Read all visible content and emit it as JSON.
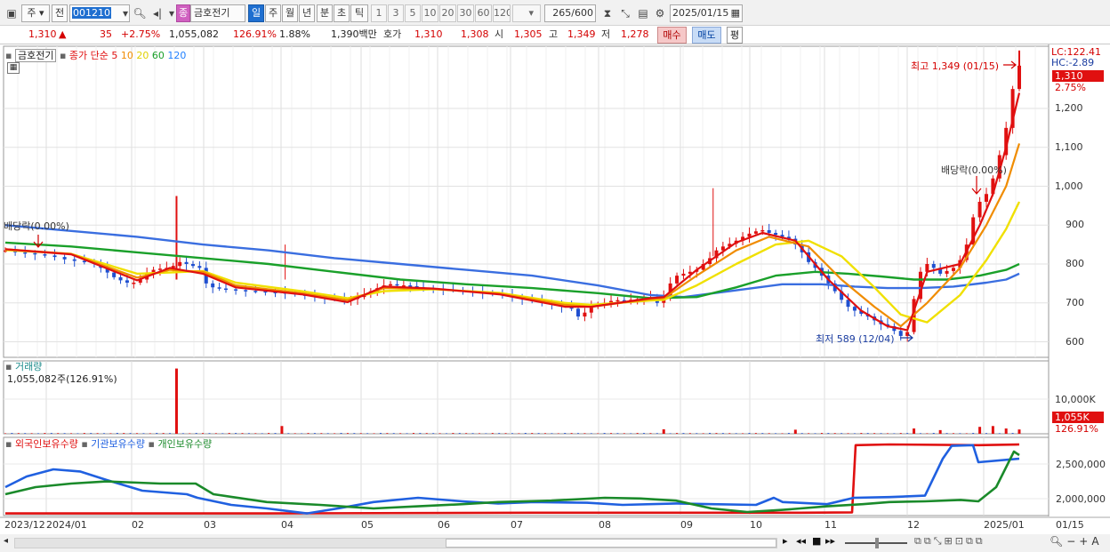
{
  "toolbar": {
    "market_type": "주",
    "prefix": "전",
    "stock_code": "001210",
    "stock_badge": "종",
    "stock_name": "금호전기",
    "period_tabs": [
      "일",
      "주",
      "월",
      "년",
      "분",
      "초",
      "틱"
    ],
    "active_period": "일",
    "interval_buttons": [
      "1",
      "3",
      "5",
      "10",
      "20",
      "30",
      "60",
      "120"
    ],
    "data_count": "265",
    "data_total": "/600",
    "date": "2025/01/15"
  },
  "quote": {
    "price": "1,310",
    "change": "35",
    "change_pct": "+2.75%",
    "volume": "1,055,082",
    "volume_ratio": "126.91%",
    "turnover": "1.88%",
    "amount": "1,390백만",
    "ask_label": "호가",
    "ask": "1,310",
    "bid": "1,308",
    "open_label": "시",
    "open": "1,305",
    "high_label": "고",
    "high": "1,349",
    "low_label": "저",
    "low": "1,278",
    "buy_label": "매수",
    "sell_label": "매도",
    "list_label": "평"
  },
  "price_pane": {
    "name": "금호전기",
    "ma_label": "종가 단순",
    "ma_periods": [
      {
        "label": "5",
        "color": "#e01010"
      },
      {
        "label": "10",
        "color": "#f08c00"
      },
      {
        "label": "20",
        "color": "#f0e000"
      },
      {
        "label": "60",
        "color": "#1aa02a"
      },
      {
        "label": "120",
        "color": "#2080ff"
      }
    ],
    "lc_label": "LC:122.41",
    "hc_label": "HC:-2.89",
    "current_price_tag": "1,310",
    "current_pct_tag": "2.75%",
    "high_annotation": "최고 1,349 (01/15)",
    "low_annotation": "최저 589 (12/04)",
    "dividend_left": "배당락(0.00%)",
    "dividend_right": "배당락(0.00%)"
  },
  "volume_pane": {
    "title": "거래량",
    "value": "1,055,082주(126.91%)",
    "axis_label": "10,000K",
    "tag_value": "1,055K",
    "tag_pct": "126.91%"
  },
  "holding_pane": {
    "series": [
      {
        "label": "외국인보유수량",
        "color": "#e01010"
      },
      {
        "label": "기관보유수량",
        "color": "#2060e0"
      },
      {
        "label": "개인보유수량",
        "color": "#1a8a2a"
      }
    ],
    "axis_labels": [
      "2,500,000",
      "2,000,000"
    ]
  },
  "x_axis": {
    "labels": [
      "2023/12",
      "2024/01",
      "02",
      "03",
      "04",
      "05",
      "06",
      "07",
      "08",
      "09",
      "10",
      "11",
      "12",
      "2025/01"
    ],
    "right_label": "01/15"
  },
  "chart_data": {
    "type": "line",
    "title": "금호전기",
    "ylim": [
      560,
      1360
    ],
    "y_ticks": [
      600,
      700,
      800,
      900,
      1000,
      1100,
      1200
    ],
    "y_tick_labels": [
      "600",
      "700",
      "800",
      "900",
      "1,000",
      "1,100",
      "1,200"
    ],
    "price_points": [
      [
        0,
        835
      ],
      [
        3,
        830
      ],
      [
        6,
        828
      ],
      [
        9,
        825
      ],
      [
        12,
        822
      ],
      [
        15,
        818
      ],
      [
        18,
        812
      ],
      [
        21,
        808
      ],
      [
        24,
        805
      ],
      [
        27,
        800
      ],
      [
        29,
        790
      ],
      [
        31,
        778
      ],
      [
        33,
        766
      ],
      [
        35,
        758
      ],
      [
        37,
        752
      ],
      [
        39,
        752
      ],
      [
        41,
        760
      ],
      [
        43,
        775
      ],
      [
        45,
        785
      ],
      [
        47,
        788
      ],
      [
        49,
        790
      ],
      [
        51,
        795
      ],
      [
        53,
        805
      ],
      [
        55,
        800
      ],
      [
        57,
        795
      ],
      [
        59,
        790
      ],
      [
        61,
        750
      ],
      [
        63,
        740
      ],
      [
        65,
        737
      ],
      [
        67,
        735
      ],
      [
        70,
        733
      ],
      [
        73,
        731
      ],
      [
        76,
        730
      ],
      [
        79,
        728
      ],
      [
        82,
        727
      ],
      [
        85,
        725
      ],
      [
        88,
        722
      ],
      [
        91,
        718
      ],
      [
        94,
        715
      ],
      [
        97,
        712
      ],
      [
        100,
        710
      ],
      [
        103,
        705
      ],
      [
        105,
        710
      ],
      [
        107,
        715
      ],
      [
        109,
        722
      ],
      [
        111,
        730
      ],
      [
        113,
        738
      ],
      [
        115,
        745
      ],
      [
        117,
        748
      ],
      [
        119,
        745
      ],
      [
        121,
        745
      ],
      [
        123,
        743
      ],
      [
        125,
        740
      ],
      [
        127,
        738
      ],
      [
        130,
        737
      ],
      [
        133,
        735
      ],
      [
        136,
        733
      ],
      [
        139,
        730
      ],
      [
        142,
        728
      ],
      [
        145,
        725
      ],
      [
        148,
        723
      ],
      [
        151,
        720
      ],
      [
        154,
        715
      ],
      [
        157,
        710
      ],
      [
        160,
        705
      ],
      [
        163,
        700
      ],
      [
        166,
        695
      ],
      [
        169,
        690
      ],
      [
        172,
        685
      ],
      [
        174,
        665
      ],
      [
        176,
        675
      ],
      [
        178,
        690
      ],
      [
        180,
        695
      ],
      [
        182,
        700
      ],
      [
        184,
        705
      ],
      [
        186,
        707
      ],
      [
        188,
        705
      ],
      [
        190,
        708
      ],
      [
        192,
        710
      ],
      [
        194,
        712
      ],
      [
        196,
        715
      ],
      [
        198,
        700
      ],
      [
        200,
        720
      ],
      [
        202,
        750
      ],
      [
        204,
        770
      ],
      [
        206,
        775
      ],
      [
        208,
        780
      ],
      [
        210,
        785
      ],
      [
        212,
        800
      ],
      [
        214,
        815
      ],
      [
        216,
        835
      ],
      [
        218,
        845
      ],
      [
        220,
        852
      ],
      [
        222,
        860
      ],
      [
        224,
        870
      ],
      [
        226,
        878
      ],
      [
        228,
        884
      ],
      [
        230,
        887
      ],
      [
        232,
        880
      ],
      [
        234,
        875
      ],
      [
        236,
        870
      ],
      [
        238,
        865
      ],
      [
        240,
        850
      ],
      [
        242,
        830
      ],
      [
        244,
        805
      ],
      [
        246,
        790
      ],
      [
        248,
        770
      ],
      [
        250,
        750
      ],
      [
        252,
        730
      ],
      [
        254,
        708
      ],
      [
        256,
        690
      ],
      [
        258,
        680
      ],
      [
        260,
        672
      ],
      [
        262,
        665
      ],
      [
        264,
        655
      ],
      [
        266,
        645
      ],
      [
        268,
        640
      ],
      [
        270,
        628
      ],
      [
        272,
        615
      ],
      [
        274,
        625
      ],
      [
        276,
        710
      ],
      [
        278,
        780
      ],
      [
        280,
        800
      ],
      [
        282,
        790
      ],
      [
        284,
        775
      ],
      [
        286,
        782
      ],
      [
        288,
        790
      ],
      [
        290,
        810
      ],
      [
        292,
        850
      ],
      [
        294,
        920
      ],
      [
        296,
        960
      ],
      [
        298,
        980
      ],
      [
        300,
        1020
      ],
      [
        302,
        1080
      ],
      [
        304,
        1150
      ],
      [
        306,
        1250
      ],
      [
        308,
        1310
      ]
    ],
    "ma5": [
      [
        0,
        838
      ],
      [
        20,
        825
      ],
      [
        40,
        758
      ],
      [
        50,
        790
      ],
      [
        60,
        775
      ],
      [
        70,
        740
      ],
      [
        90,
        722
      ],
      [
        104,
        702
      ],
      [
        115,
        742
      ],
      [
        130,
        737
      ],
      [
        150,
        722
      ],
      [
        170,
        690
      ],
      [
        178,
        690
      ],
      [
        196,
        712
      ],
      [
        200,
        715
      ],
      [
        210,
        785
      ],
      [
        222,
        855
      ],
      [
        230,
        880
      ],
      [
        240,
        860
      ],
      [
        250,
        760
      ],
      [
        260,
        680
      ],
      [
        268,
        640
      ],
      [
        274,
        630
      ],
      [
        280,
        780
      ],
      [
        290,
        800
      ],
      [
        296,
        900
      ],
      [
        300,
        980
      ],
      [
        304,
        1100
      ],
      [
        308,
        1240
      ]
    ],
    "ma10": [
      [
        0,
        838
      ],
      [
        20,
        826
      ],
      [
        40,
        765
      ],
      [
        50,
        785
      ],
      [
        60,
        780
      ],
      [
        70,
        745
      ],
      [
        90,
        725
      ],
      [
        104,
        707
      ],
      [
        115,
        738
      ],
      [
        130,
        736
      ],
      [
        150,
        724
      ],
      [
        170,
        695
      ],
      [
        178,
        690
      ],
      [
        196,
        710
      ],
      [
        200,
        712
      ],
      [
        210,
        770
      ],
      [
        222,
        835
      ],
      [
        232,
        870
      ],
      [
        244,
        845
      ],
      [
        254,
        760
      ],
      [
        264,
        690
      ],
      [
        272,
        640
      ],
      [
        280,
        700
      ],
      [
        290,
        790
      ],
      [
        298,
        900
      ],
      [
        304,
        1000
      ],
      [
        308,
        1110
      ]
    ],
    "ma20": [
      [
        0,
        836
      ],
      [
        20,
        826
      ],
      [
        40,
        775
      ],
      [
        50,
        778
      ],
      [
        60,
        782
      ],
      [
        70,
        752
      ],
      [
        90,
        730
      ],
      [
        104,
        712
      ],
      [
        115,
        730
      ],
      [
        130,
        735
      ],
      [
        150,
        726
      ],
      [
        170,
        700
      ],
      [
        178,
        695
      ],
      [
        196,
        706
      ],
      [
        200,
        708
      ],
      [
        210,
        745
      ],
      [
        222,
        800
      ],
      [
        234,
        850
      ],
      [
        244,
        860
      ],
      [
        254,
        820
      ],
      [
        264,
        740
      ],
      [
        272,
        670
      ],
      [
        280,
        650
      ],
      [
        290,
        720
      ],
      [
        298,
        810
      ],
      [
        304,
        890
      ],
      [
        308,
        960
      ]
    ],
    "ma60": [
      [
        0,
        855
      ],
      [
        20,
        845
      ],
      [
        40,
        830
      ],
      [
        60,
        815
      ],
      [
        80,
        800
      ],
      [
        100,
        780
      ],
      [
        120,
        760
      ],
      [
        140,
        748
      ],
      [
        160,
        738
      ],
      [
        180,
        725
      ],
      [
        196,
        712
      ],
      [
        210,
        715
      ],
      [
        222,
        740
      ],
      [
        234,
        770
      ],
      [
        246,
        780
      ],
      [
        256,
        775
      ],
      [
        266,
        768
      ],
      [
        276,
        760
      ],
      [
        286,
        760
      ],
      [
        296,
        770
      ],
      [
        304,
        785
      ],
      [
        308,
        800
      ]
    ],
    "ma120": [
      [
        0,
        900
      ],
      [
        20,
        885
      ],
      [
        40,
        870
      ],
      [
        60,
        850
      ],
      [
        80,
        835
      ],
      [
        100,
        815
      ],
      [
        120,
        800
      ],
      [
        140,
        785
      ],
      [
        160,
        770
      ],
      [
        180,
        745
      ],
      [
        196,
        720
      ],
      [
        206,
        715
      ],
      [
        220,
        730
      ],
      [
        236,
        748
      ],
      [
        248,
        748
      ],
      [
        258,
        742
      ],
      [
        268,
        738
      ],
      [
        278,
        738
      ],
      [
        288,
        742
      ],
      [
        298,
        752
      ],
      [
        304,
        760
      ],
      [
        308,
        775
      ]
    ],
    "volume": {
      "baseline": 0,
      "spikes": [
        [
          52,
          16000
        ],
        [
          84,
          1900
        ],
        [
          200,
          1100
        ],
        [
          240,
          1000
        ],
        [
          276,
          1300
        ],
        [
          284,
          900
        ],
        [
          296,
          1700
        ],
        [
          300,
          1900
        ],
        [
          304,
          1300
        ],
        [
          308,
          1055
        ]
      ]
    }
  }
}
